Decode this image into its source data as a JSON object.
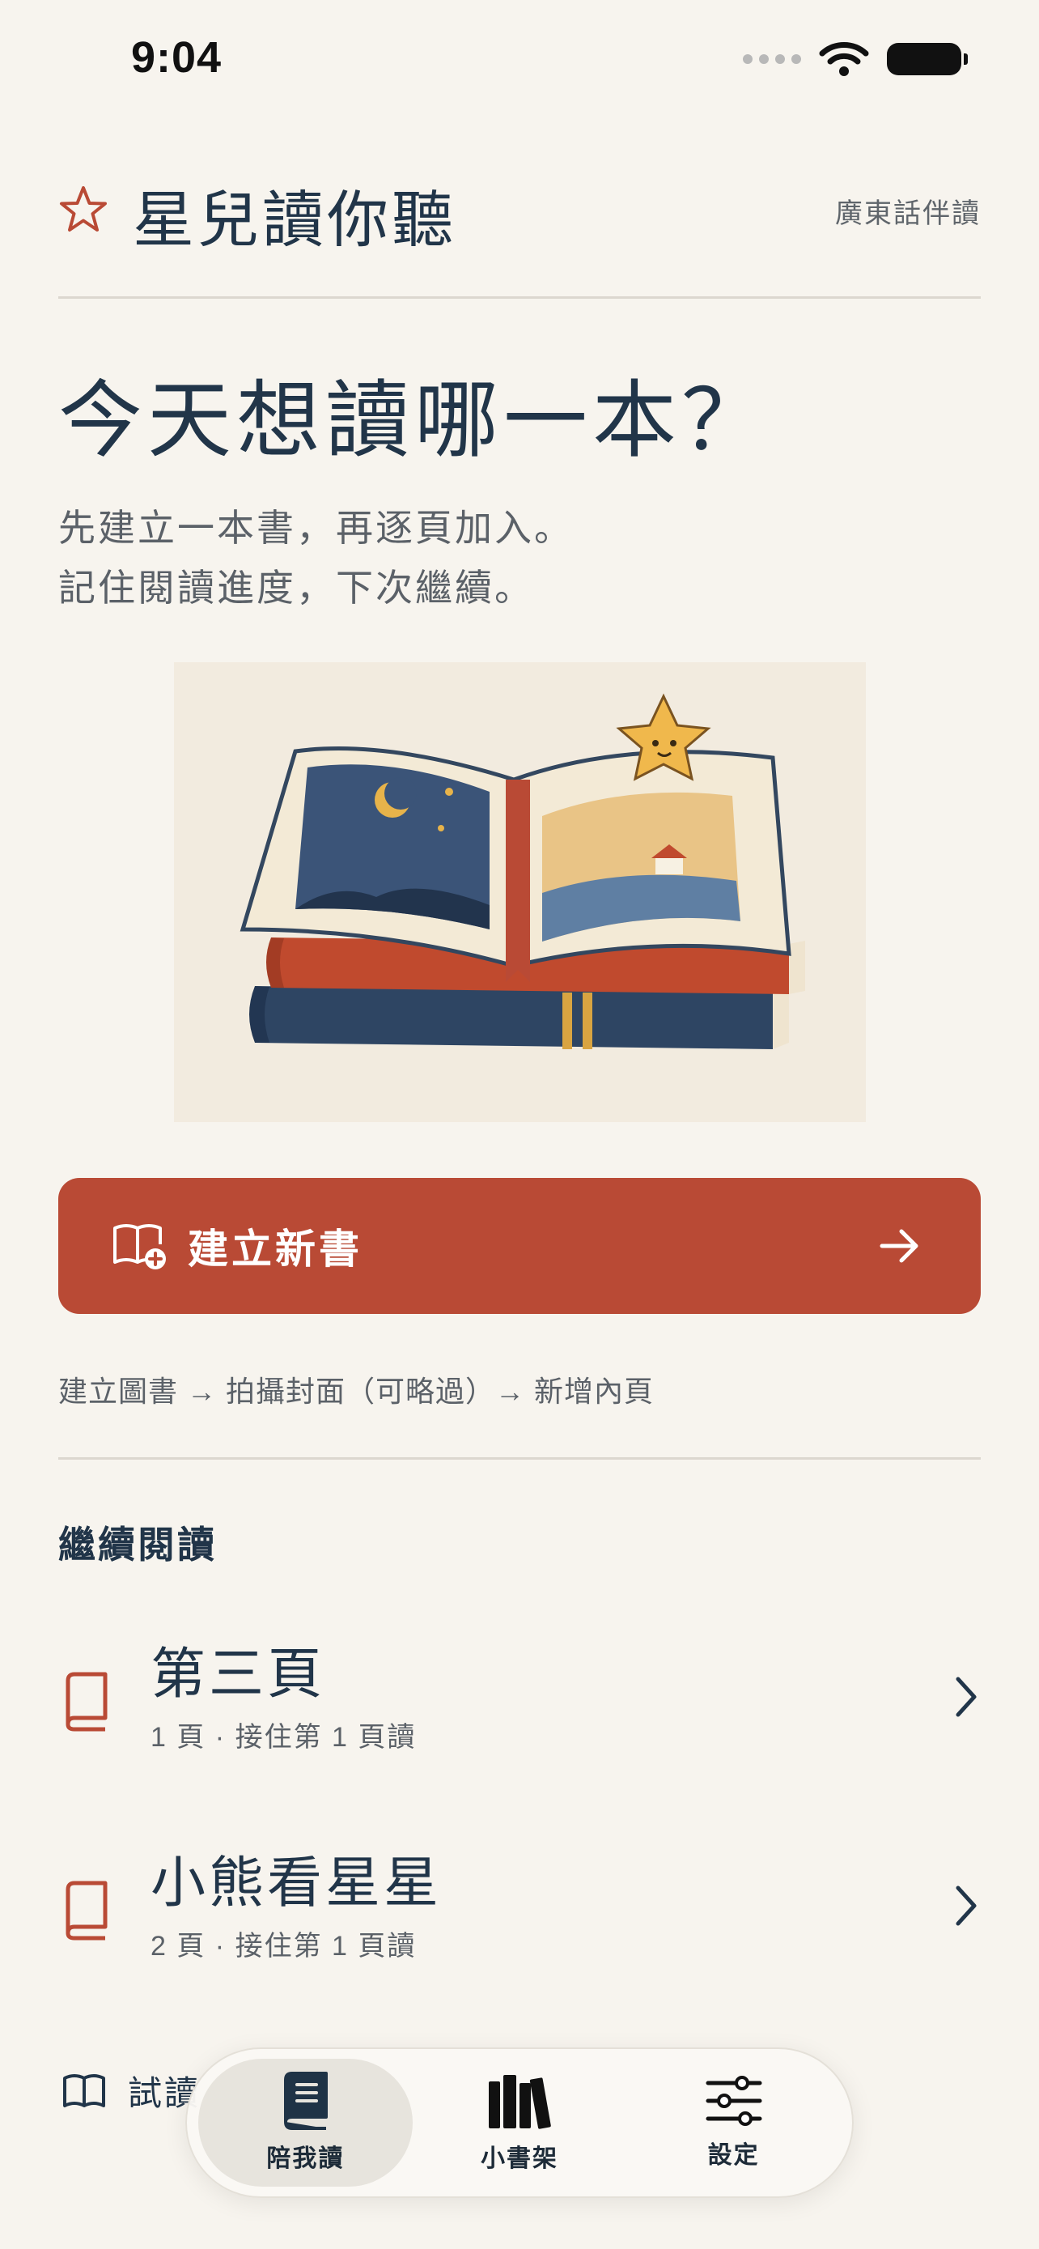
{
  "status": {
    "time": "9:04"
  },
  "header": {
    "title": "星兒讀你聽",
    "mode": "廣東話伴讀"
  },
  "hero": {
    "headline": "今天想讀哪一本？",
    "subtitle_line1": "先建立一本書，再逐頁加入。",
    "subtitle_line2": "記住閱讀進度，下次繼續。"
  },
  "create": {
    "label": "建立新書",
    "steps": "建立圖書 → 拍攝封面（可略過）→ 新增內頁"
  },
  "continue_reading": {
    "title": "繼續閱讀",
    "books": [
      {
        "title": "第三頁",
        "meta": "1 頁 · 接住第 1 頁讀"
      },
      {
        "title": "小熊看星星",
        "meta": "2 頁 · 接住第 1 頁讀"
      }
    ]
  },
  "trial": {
    "label": "試讀"
  },
  "tabs": [
    {
      "label": "陪我讀",
      "icon": "book-icon",
      "active": true
    },
    {
      "label": "小書架",
      "icon": "bookshelf-icon",
      "active": false
    },
    {
      "label": "設定",
      "icon": "sliders-icon",
      "active": false
    }
  ],
  "colors": {
    "accent": "#b94a35",
    "text": "#213549",
    "background": "#f7f4ee"
  }
}
